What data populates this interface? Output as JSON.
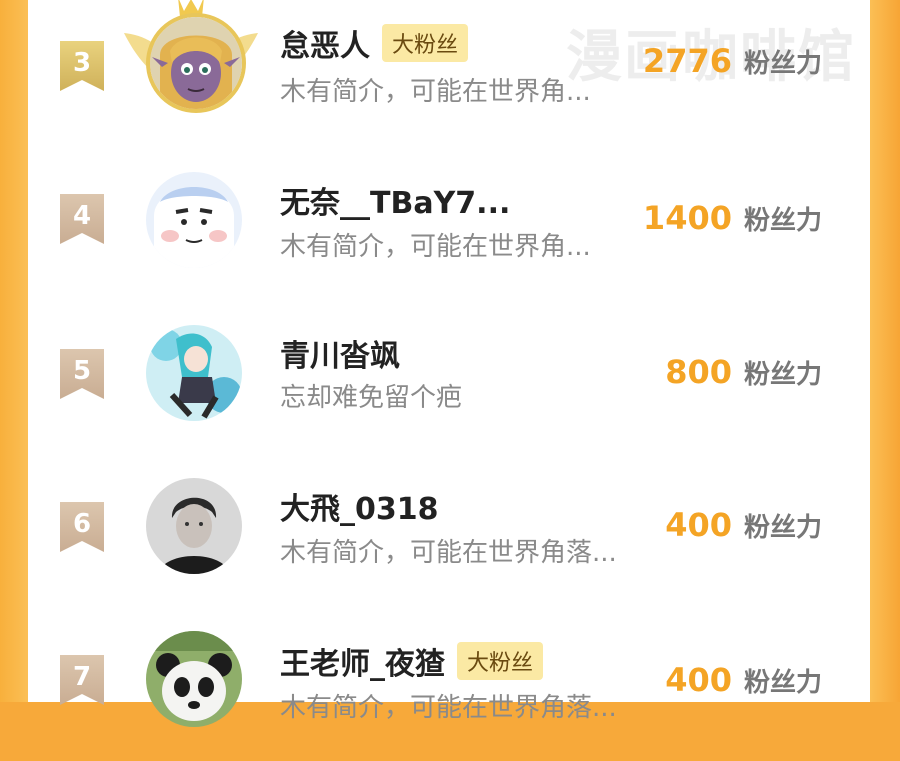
{
  "watermark": "漫画咖啡馆",
  "score_unit": "粉丝力",
  "colors": {
    "accent": "#f7a93a",
    "score": "#f4a425",
    "badge_bg": "#fbe9a4"
  },
  "rows": [
    {
      "rank": "3",
      "name": "怠恶人",
      "badge": "大粉丝",
      "bio": "木有简介，可能在世界角...",
      "score": "2776",
      "avatar": "elf-girl-avatar"
    },
    {
      "rank": "4",
      "name": "无奈__TBaY7...",
      "badge": "",
      "bio": "木有简介，可能在世界角...",
      "score": "1400",
      "avatar": "cartoon-boy-avatar"
    },
    {
      "rank": "5",
      "name": "青川沓飒",
      "badge": "",
      "bio": "忘却难免留个疤",
      "score": "800",
      "avatar": "anime-girl-avatar"
    },
    {
      "rank": "6",
      "name": "大飛_0318",
      "badge": "",
      "bio": "木有简介，可能在世界角落...",
      "score": "400",
      "avatar": "portrait-avatar"
    },
    {
      "rank": "7",
      "name": "王老师_夜猹",
      "badge": "大粉丝",
      "bio": "木有简介，可能在世界角落...",
      "score": "400",
      "avatar": "panda-avatar"
    }
  ]
}
